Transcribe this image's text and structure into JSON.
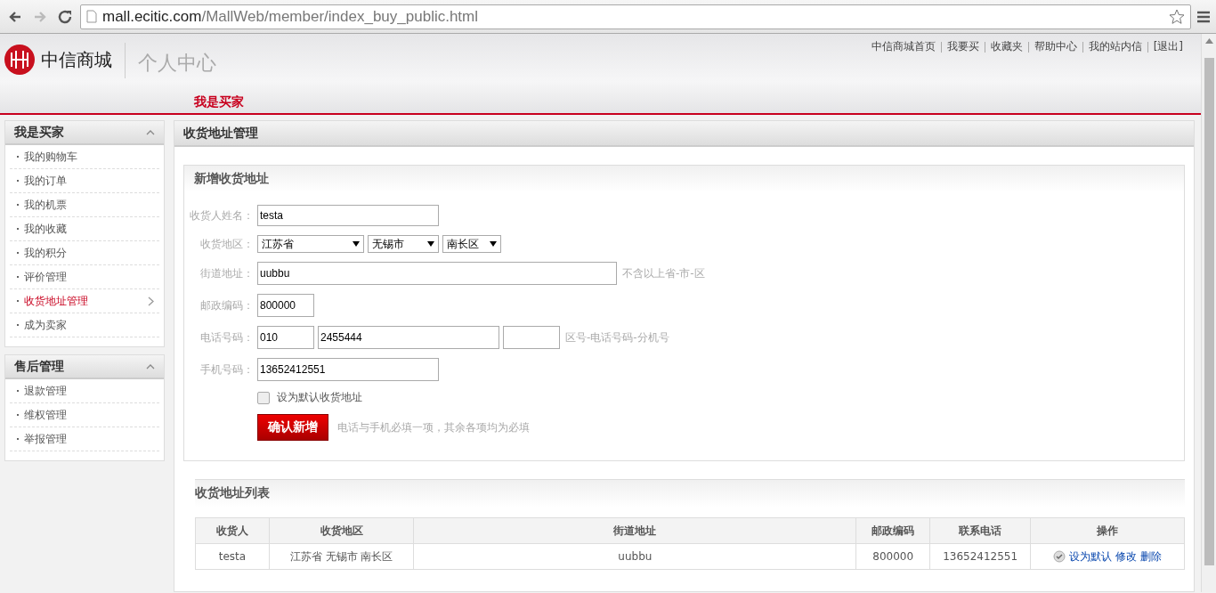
{
  "browser": {
    "url_host": "mall.ecitic.com",
    "url_path": "/MallWeb/member/index_buy_public.html"
  },
  "header": {
    "logo_text": "中信商城",
    "section_title": "个人中心",
    "top_links": [
      "中信商城首页",
      "我要买",
      "收藏夹",
      "帮助中心",
      "我的站内信",
      "[退出]"
    ],
    "tabs": [
      {
        "label": "我是买家",
        "selected": true
      }
    ]
  },
  "sidebar": {
    "groups": [
      {
        "title": "我是买家",
        "expanded": true,
        "items": [
          {
            "label": "我的购物车",
            "selected": false
          },
          {
            "label": "我的订单",
            "selected": false
          },
          {
            "label": "我的机票",
            "selected": false
          },
          {
            "label": "我的收藏",
            "selected": false
          },
          {
            "label": "我的积分",
            "selected": false
          },
          {
            "label": "评价管理",
            "selected": false
          },
          {
            "label": "收货地址管理",
            "selected": true
          },
          {
            "label": "成为卖家",
            "selected": false
          }
        ]
      },
      {
        "title": "售后管理",
        "expanded": true,
        "items": [
          {
            "label": "退款管理",
            "selected": false
          },
          {
            "label": "维权管理",
            "selected": false
          },
          {
            "label": "举报管理",
            "selected": false
          }
        ]
      }
    ]
  },
  "main": {
    "title": "收货地址管理",
    "form": {
      "title": "新增收货地址",
      "name": {
        "label": "收货人姓名：",
        "value": "testa"
      },
      "region": {
        "label": "收货地区：",
        "selects": [
          "江苏省",
          "无锡市",
          "南长区"
        ]
      },
      "street": {
        "label": "街道地址：",
        "value": "uubbu",
        "hint": "不含以上省-市-区"
      },
      "zip": {
        "label": "邮政编码：",
        "value": "800000"
      },
      "phone": {
        "label": "电话号码：",
        "values": [
          "010",
          "2455444"
        ],
        "hint": "区号-电话号码-分机号"
      },
      "mobile": {
        "label": "手机号码：",
        "value": "13652412551"
      },
      "default_checkbox": {
        "label": "设为默认收货地址",
        "checked": false
      },
      "submit": "确认新增",
      "note": "电话与手机必填一项，其余各项均为必填"
    },
    "list": {
      "title": "收货地址列表",
      "columns": [
        "收货人",
        "收货地区",
        "街道地址",
        "邮政编码",
        "联系电话",
        "操作"
      ],
      "rows": [
        {
          "cells": [
            "testa",
            "江苏省 无锡市 南长区",
            "uubbu",
            "800000",
            "13652412551"
          ],
          "actions": [
            "设为默认",
            "修改",
            "删除"
          ]
        }
      ]
    }
  }
}
